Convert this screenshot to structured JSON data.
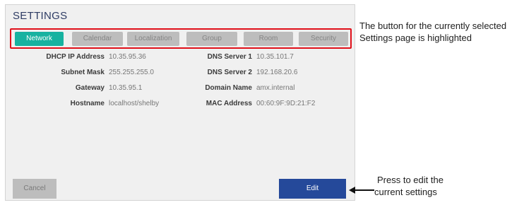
{
  "window": {
    "title": "SETTINGS"
  },
  "tabs": [
    {
      "label": "Network",
      "active": true
    },
    {
      "label": "Calendar",
      "active": false
    },
    {
      "label": "Localization",
      "active": false
    },
    {
      "label": "Group",
      "active": false
    },
    {
      "label": "Room",
      "active": false
    },
    {
      "label": "Security",
      "active": false
    }
  ],
  "network": {
    "left": [
      {
        "label": "DHCP IP Address",
        "value": "10.35.95.36"
      },
      {
        "label": "Subnet Mask",
        "value": "255.255.255.0"
      },
      {
        "label": "Gateway",
        "value": "10.35.95.1"
      },
      {
        "label": "Hostname",
        "value": "localhost/shelby"
      }
    ],
    "right": [
      {
        "label": "DNS Server 1",
        "value": "10.35.101.7"
      },
      {
        "label": "DNS Server 2",
        "value": "192.168.20.6"
      },
      {
        "label": "Domain Name",
        "value": "amx.internal"
      },
      {
        "label": "MAC Address",
        "value": "00:60:9F:9D:21:F2"
      }
    ]
  },
  "buttons": {
    "cancel_label": "Cancel",
    "edit_label": "Edit"
  },
  "annotations": {
    "tabs_note": "The button for the currently selected Settings page is highlighted",
    "edit_note_line1": "Press to edit the",
    "edit_note_line2": "current settings"
  },
  "colors": {
    "active_tab": "#17b2a0",
    "inactive_tab": "#bdbdbd",
    "edit_button": "#25499a",
    "highlight_outline": "#e0101a",
    "title": "#2d3b63"
  }
}
